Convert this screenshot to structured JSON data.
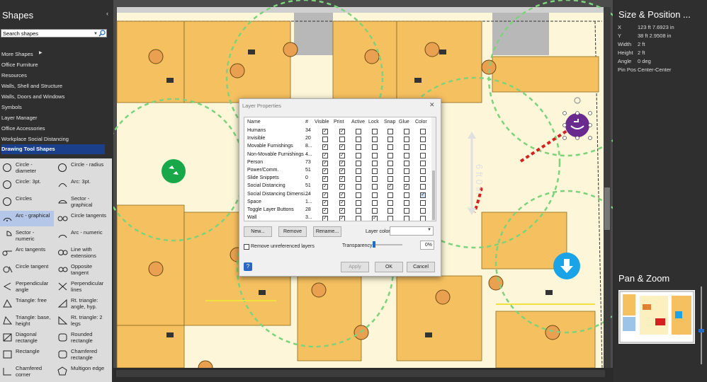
{
  "shapes_panel": {
    "title": "Shapes",
    "collapse_glyph": "‹",
    "search_placeholder": "Search shapes",
    "stencils": [
      {
        "label": "More Shapes",
        "active": false
      },
      {
        "label": "Office Furniture",
        "active": false
      },
      {
        "label": "Resources",
        "active": false
      },
      {
        "label": "Walls, Shell and Structure",
        "active": false
      },
      {
        "label": "Walls, Doors and Windows",
        "active": false
      },
      {
        "label": "Symbols",
        "active": false
      },
      {
        "label": "Layer Manager",
        "active": false
      },
      {
        "label": "Office Accessories",
        "active": false
      },
      {
        "label": "Workplace Social Distancing",
        "active": false
      },
      {
        "label": "Drawing Tool Shapes",
        "active": true
      }
    ],
    "shapes": [
      {
        "label": "Circle - diameter",
        "icon": "circle-diameter-icon"
      },
      {
        "label": "Circle - radius",
        "icon": "circle-radius-icon"
      },
      {
        "label": "Circle: 3pt.",
        "icon": "circle-3pt-icon"
      },
      {
        "label": "Arc: 3pt.",
        "icon": "arc-3pt-icon"
      },
      {
        "label": "Circles",
        "icon": "circles-icon"
      },
      {
        "label": "Sector - graphical",
        "icon": "sector-graphical-icon"
      },
      {
        "label": "Arc - graphical",
        "icon": "arc-graphical-icon",
        "selected": true
      },
      {
        "label": "Circle tangents",
        "icon": "circle-tangents-icon"
      },
      {
        "label": "Sector - numeric",
        "icon": "sector-numeric-icon"
      },
      {
        "label": "Arc - numeric",
        "icon": "arc-numeric-icon"
      },
      {
        "label": "Arc tangents",
        "icon": "arc-tangents-icon"
      },
      {
        "label": "Line with extensions",
        "icon": "line-extensions-icon"
      },
      {
        "label": "Circle tangent",
        "icon": "circle-tangent-icon"
      },
      {
        "label": "Opposite tangent",
        "icon": "opposite-tangent-icon"
      },
      {
        "label": "Perpendicular angle",
        "icon": "perpendicular-angle-icon"
      },
      {
        "label": "Perpendicular lines",
        "icon": "perpendicular-lines-icon"
      },
      {
        "label": "Triangle: free",
        "icon": "triangle-free-icon"
      },
      {
        "label": "Rt. triangle: angle, hyp.",
        "icon": "rt-triangle-angle-icon"
      },
      {
        "label": "Triangle: base, height",
        "icon": "triangle-base-height-icon"
      },
      {
        "label": "Rt. triangle: 2 legs",
        "icon": "rt-triangle-legs-icon"
      },
      {
        "label": "Diagonal rectangle",
        "icon": "diagonal-rectangle-icon"
      },
      {
        "label": "Rounded rectangle",
        "icon": "rounded-rectangle-icon"
      },
      {
        "label": "Rectangle",
        "icon": "rectangle-icon"
      },
      {
        "label": "Chamfered rectangle",
        "icon": "chamfered-rectangle-icon"
      },
      {
        "label": "Chamfered corner",
        "icon": "chamfered-corner-icon"
      },
      {
        "label": "Multigon edge",
        "icon": "multigon-edge-icon"
      }
    ]
  },
  "size_position": {
    "title": "Size & Position ...",
    "rows": [
      {
        "key": "X",
        "value": "123 ft 7.6923 in"
      },
      {
        "key": "Y",
        "value": "38 ft 2.9508 in"
      },
      {
        "key": "Width",
        "value": "2 ft"
      },
      {
        "key": "Height",
        "value": "2 ft"
      },
      {
        "key": "Angle",
        "value": "0 deg"
      },
      {
        "key": "Pin Pos",
        "value": "Center-Center"
      }
    ]
  },
  "pan_zoom": {
    "title": "Pan & Zoom"
  },
  "canvas": {
    "dimension_label": "6 ft 0 in",
    "colors": {
      "desk": "#f5c060",
      "floor": "#fdf6d8",
      "wall": "#7a7a7a",
      "dist_circle": "#7cd37c",
      "accent_red": "#d62020"
    }
  },
  "dialog": {
    "title": "Layer Properties",
    "close_glyph": "✕",
    "columns": [
      "Name",
      "#",
      "Visible",
      "Print",
      "Active",
      "Lock",
      "Snap",
      "Glue",
      "Color"
    ],
    "layers": [
      {
        "name": "Humans",
        "count": "34",
        "visible": true,
        "print": true,
        "active": false,
        "lock": false,
        "snap": false,
        "glue": false,
        "color": false
      },
      {
        "name": "Invisible",
        "count": "20",
        "visible": false,
        "print": false,
        "active": false,
        "lock": false,
        "snap": false,
        "glue": false,
        "color": false
      },
      {
        "name": "Movable Furnishings",
        "count": "8...",
        "visible": true,
        "print": true,
        "active": false,
        "lock": false,
        "snap": false,
        "glue": false,
        "color": false
      },
      {
        "name": "Non-Movable Furnishings",
        "count": "4...",
        "visible": true,
        "print": true,
        "active": false,
        "lock": false,
        "snap": false,
        "glue": false,
        "color": false
      },
      {
        "name": "Person",
        "count": "73",
        "visible": true,
        "print": true,
        "active": false,
        "lock": false,
        "snap": false,
        "glue": false,
        "color": false
      },
      {
        "name": "Power/Comm.",
        "count": "51",
        "visible": true,
        "print": true,
        "active": false,
        "lock": false,
        "snap": false,
        "glue": false,
        "color": false
      },
      {
        "name": "Slide Snippets",
        "count": "0",
        "visible": true,
        "print": true,
        "active": false,
        "lock": false,
        "snap": false,
        "glue": false,
        "color": false
      },
      {
        "name": "Social Distancing",
        "count": "51",
        "visible": true,
        "print": true,
        "active": false,
        "lock": false,
        "snap": true,
        "glue": true,
        "color": false
      },
      {
        "name": "Social Distancing Dimensi...",
        "count": "24",
        "visible": true,
        "print": true,
        "active": false,
        "lock": false,
        "snap": false,
        "glue": false,
        "color": true
      },
      {
        "name": "Space",
        "count": "1...",
        "visible": true,
        "print": true,
        "active": false,
        "lock": false,
        "snap": false,
        "glue": false,
        "color": false
      },
      {
        "name": "Toggle Layer Buttons",
        "count": "28",
        "visible": true,
        "print": true,
        "active": false,
        "lock": false,
        "snap": false,
        "glue": false,
        "color": false
      },
      {
        "name": "Wall",
        "count": "3...",
        "visible": true,
        "print": true,
        "active": false,
        "lock": true,
        "snap": false,
        "glue": false,
        "color": false
      }
    ],
    "buttons": {
      "new": "New...",
      "remove": "Remove",
      "rename": "Rename...",
      "apply": "Apply",
      "ok": "OK",
      "cancel": "Cancel"
    },
    "layer_color_label": "Layer color:",
    "remove_unreferenced_label": "Remove unreferenced layers",
    "transparency_label": "Transparency:",
    "transparency_value": "0%",
    "help_glyph": "?"
  }
}
